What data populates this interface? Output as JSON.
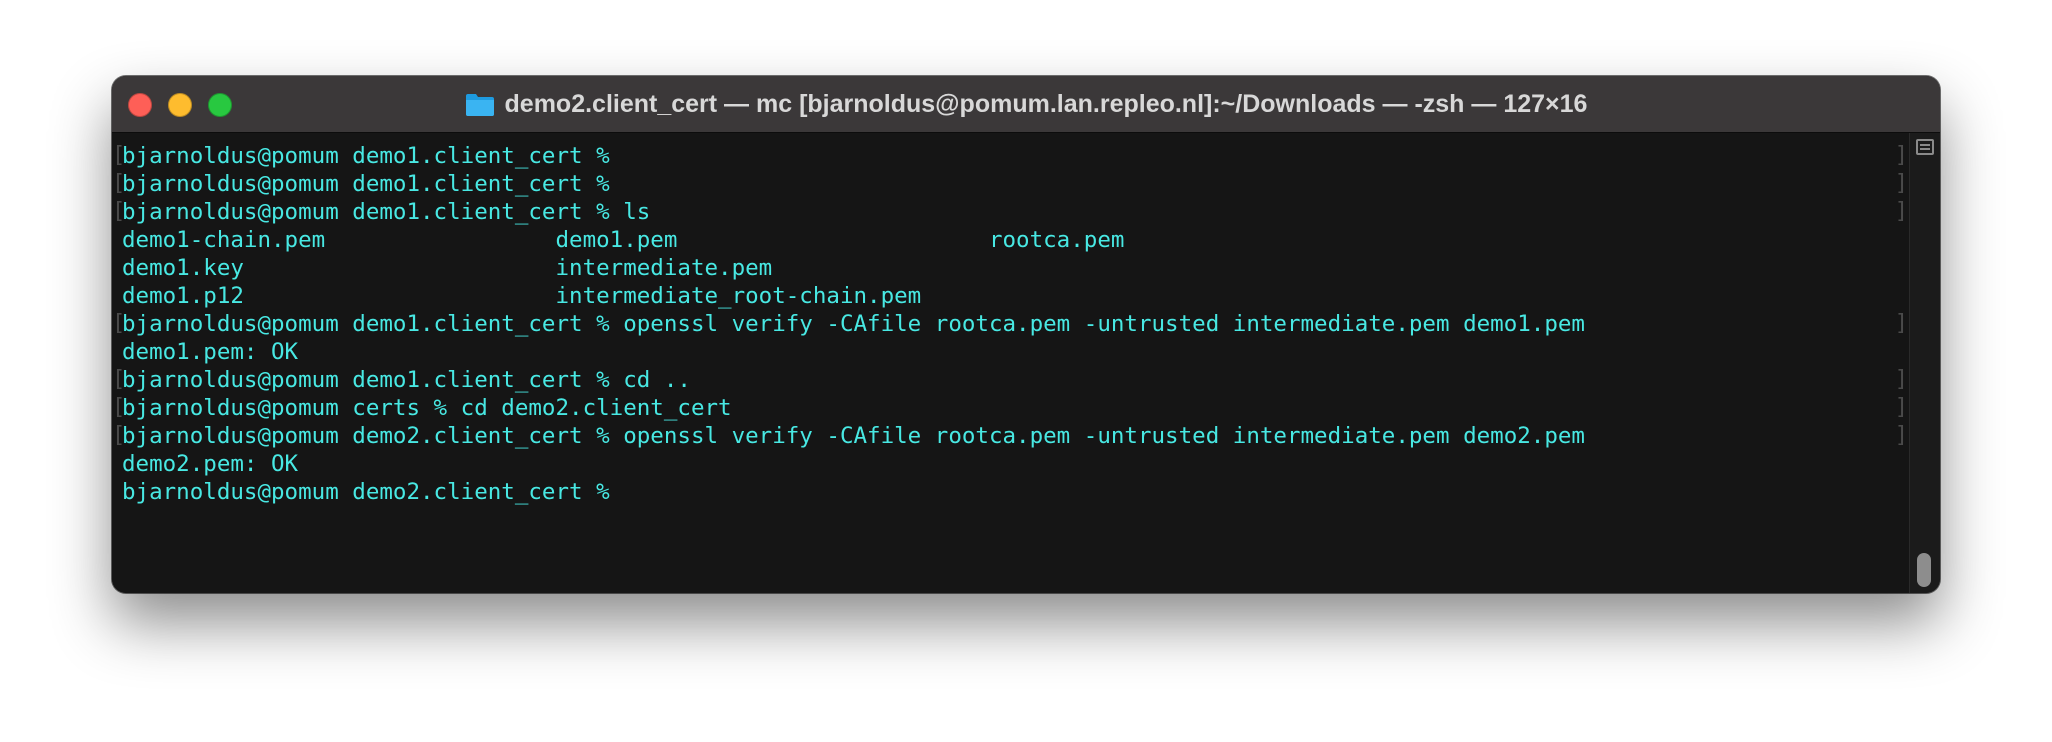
{
  "window": {
    "title": "demo2.client_cert — mc [bjarnoldus@pomum.lan.repleo.nl]:~/Downloads — -zsh — 127×16",
    "folder_icon": "folder-icon"
  },
  "terminal": {
    "lines": [
      {
        "text": "bjarnoldus@pomum demo1.client_cert %",
        "bracketed": true
      },
      {
        "text": "bjarnoldus@pomum demo1.client_cert %",
        "bracketed": true
      },
      {
        "text": "bjarnoldus@pomum demo1.client_cert % ls",
        "bracketed": true
      },
      {
        "text": "demo1-chain.pem                 demo1.pem                       rootca.pem",
        "bracketed": false
      },
      {
        "text": "demo1.key                       intermediate.pem",
        "bracketed": false
      },
      {
        "text": "demo1.p12                       intermediate_root-chain.pem",
        "bracketed": false
      },
      {
        "text": "bjarnoldus@pomum demo1.client_cert % openssl verify -CAfile rootca.pem -untrusted intermediate.pem demo1.pem",
        "bracketed": true
      },
      {
        "text": "demo1.pem: OK",
        "bracketed": false
      },
      {
        "text": "bjarnoldus@pomum demo1.client_cert % cd ..",
        "bracketed": true
      },
      {
        "text": "bjarnoldus@pomum certs % cd demo2.client_cert",
        "bracketed": true
      },
      {
        "text": "bjarnoldus@pomum demo2.client_cert % openssl verify -CAfile rootca.pem -untrusted intermediate.pem demo2.pem",
        "bracketed": true
      },
      {
        "text": "demo2.pem: OK",
        "bracketed": false
      },
      {
        "text": "bjarnoldus@pomum demo2.client_cert %",
        "bracketed": false
      }
    ],
    "bracket_left": "[",
    "bracket_right": "]"
  },
  "colors": {
    "text": "#48e8e3",
    "background": "#151515",
    "titlebar": "#3b3839",
    "close": "#fe5f57",
    "minimize": "#febc2e",
    "zoom": "#28c840"
  }
}
